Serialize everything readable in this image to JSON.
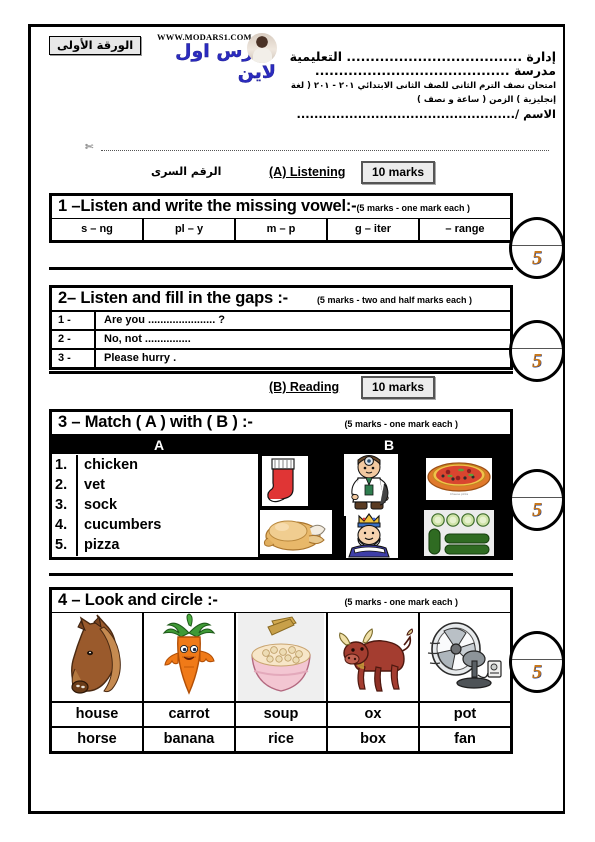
{
  "header": {
    "paper_badge": "الورقة الأولى",
    "logo_url": "WWW.MODARS1.COM",
    "logo_word": "مدرس اول لاين",
    "admin_line1": "إدارة ..................................... التعليمية",
    "admin_line2": "مدرسة .........................................",
    "admin_line3": "امتحان نصف الترم الثانى للصف الثانى الابتدائي   ٢٠١   -   ٢٠١     ( لغة إنجليزية ) الزمن ( ساعة و نصف )",
    "name_line": "الاسم /..................................................",
    "secret_number": "الرقم  السرى"
  },
  "sections": [
    {
      "title": "(A) Listening",
      "marks": "10 marks"
    },
    {
      "title": "(B) Reading",
      "marks": "10 marks"
    }
  ],
  "questions": {
    "q1": {
      "title": "1 –Listen and write the missing vowel:-",
      "marks": "(5 marks - one mark each )",
      "score": "5",
      "cells": [
        "s – ng",
        "pl – y",
        "m – p",
        "g – iter",
        "– range"
      ]
    },
    "q2": {
      "title": "2– Listen and fill in the gaps  :-",
      "marks": "(5 marks - two and half marks  each )",
      "score": "5",
      "rows": [
        {
          "num": "1 -",
          "text": "Are you ...................... ?"
        },
        {
          "num": "2 -",
          "text": "No, not ..............."
        },
        {
          "num": "3 -",
          "text": "Please hurry ."
        }
      ]
    },
    "q3": {
      "title": "3 – Match  ( A )   with  ( B ) :-",
      "marks": "(5 marks - one mark each )",
      "score": "5",
      "col_a_label": "A",
      "col_b_label": "B",
      "items": [
        {
          "num": "1.",
          "word": "chicken"
        },
        {
          "num": "2.",
          "word": "vet"
        },
        {
          "num": "3.",
          "word": "sock"
        },
        {
          "num": "4.",
          "word": "cucumbers"
        },
        {
          "num": "5.",
          "word": "pizza"
        }
      ],
      "pictures": [
        "sock-image",
        "vet-image",
        "pizza-image",
        "chicken-image",
        "king-image",
        "cucumbers-image"
      ]
    },
    "q4": {
      "title": "4 – Look and circle :-",
      "marks": "(5 marks - one mark each )",
      "score": "5",
      "pictures": [
        "horse-image",
        "carrot-image",
        "soup-bowl-image",
        "ox-image",
        "fan-image"
      ],
      "choices_top": [
        "house",
        "carrot",
        "soup",
        "ox",
        "pot"
      ],
      "choices_bottom": [
        "horse",
        "banana",
        "rice",
        "box",
        "fan"
      ]
    }
  },
  "colors": {
    "score_digit": "#c8771a",
    "logo_blue": "#2b2bbf",
    "marks_box_bg": "#ececec"
  }
}
